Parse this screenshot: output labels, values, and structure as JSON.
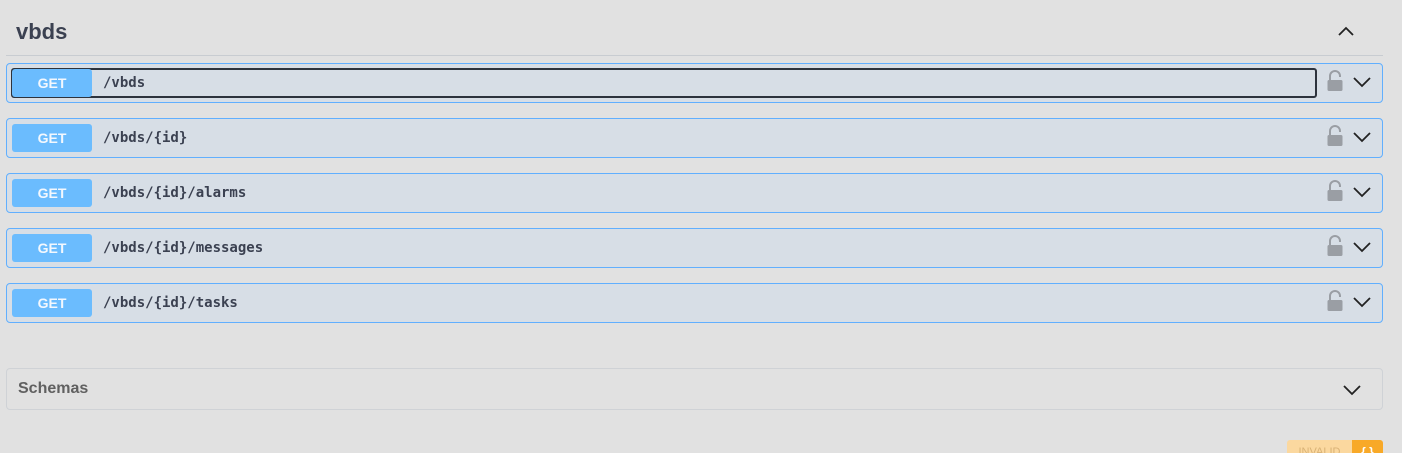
{
  "tag": {
    "title": "vbds"
  },
  "operations": [
    {
      "method": "GET",
      "path": "/vbds"
    },
    {
      "method": "GET",
      "path": "/vbds/{id}"
    },
    {
      "method": "GET",
      "path": "/vbds/{id}/alarms"
    },
    {
      "method": "GET",
      "path": "/vbds/{id}/messages"
    },
    {
      "method": "GET",
      "path": "/vbds/{id}/tasks"
    }
  ],
  "schemas": {
    "title": "Schemas"
  },
  "validator": {
    "status": "INVALID",
    "icon": "{ }"
  },
  "icons": {
    "collapse": "chevron-up-icon",
    "expand": "chevron-down-icon",
    "lock": "lock-open-icon"
  },
  "colors": {
    "get_method": "#6bbcfe",
    "get_border": "#61affe",
    "row_background": "#d7dee6",
    "validator_invalid": "#f8a928"
  }
}
